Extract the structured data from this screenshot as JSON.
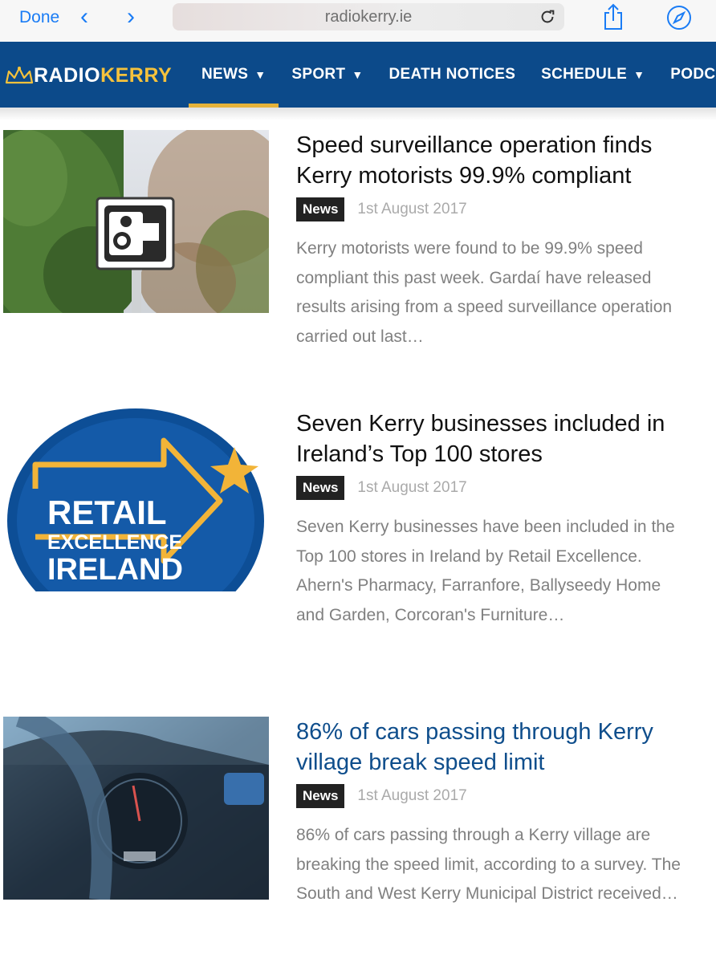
{
  "browser": {
    "done_label": "Done",
    "back_icon": "chevron-left-icon",
    "forward_icon": "chevron-right-icon",
    "url": "radiokerry.ie",
    "accent_color": "#1a7cf5"
  },
  "site": {
    "logo_part1": "RADIO",
    "logo_part2": "KERRY",
    "brand_color": "#0c4a8a",
    "accent_color": "#e6b33a",
    "menu": [
      {
        "label": "NEWS",
        "dropdown": true,
        "active": true
      },
      {
        "label": "SPORT",
        "dropdown": true,
        "active": false
      },
      {
        "label": "DEATH NOTICES",
        "dropdown": false,
        "active": false
      },
      {
        "label": "SCHEDULE",
        "dropdown": true,
        "active": false
      },
      {
        "label": "PODCAST",
        "dropdown": false,
        "active": false
      }
    ]
  },
  "articles": [
    {
      "title": "Speed surveillance operation finds Kerry motorists 99.9% compliant",
      "category": "News",
      "date": "1st August 2017",
      "excerpt": "Kerry motorists were found to be 99.9% speed compliant this past week. Gardaí have released results arising from a speed surveillance operation carried out last…"
    },
    {
      "title": "Seven Kerry businesses included in Ireland’s Top 100 stores",
      "category": "News",
      "date": "1st August 2017",
      "excerpt": "Seven Kerry businesses have been included in the Top 100 stores in Ireland by Retail Excellence. Ahern's Pharmacy, Farranfore, Ballyseedy Home and Garden, Corcoran's Furniture…",
      "image_text": [
        "RETAIL",
        "EXCELLENCE",
        "IRELAND"
      ]
    },
    {
      "title": "86% of cars passing through Kerry village break speed limit",
      "category": "News",
      "date": "1st August 2017",
      "excerpt": "86% of cars passing through a Kerry village are breaking the speed limit, according to a survey. The South and West Kerry Municipal District received…"
    }
  ]
}
